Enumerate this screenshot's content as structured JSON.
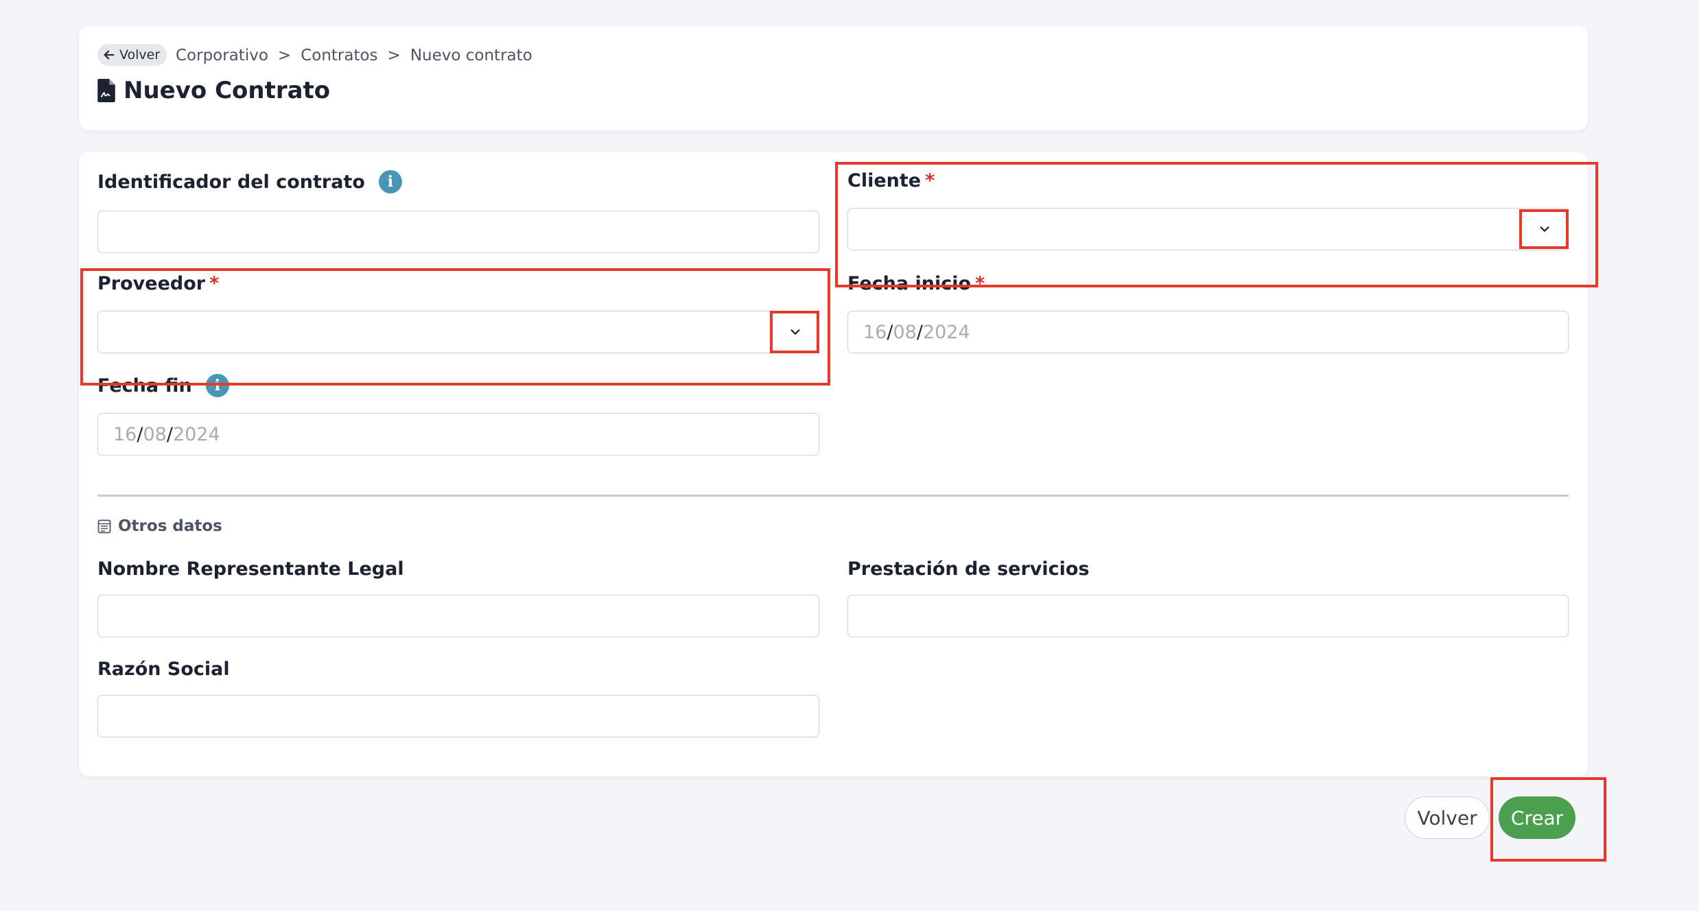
{
  "header": {
    "back_label": "Volver",
    "breadcrumb": [
      "Corporativo",
      "Contratos",
      "Nuevo contrato"
    ],
    "breadcrumb_separator": ">",
    "title": "Nuevo Contrato"
  },
  "form": {
    "contract_id": {
      "label": "Identificador del contrato",
      "value": "",
      "info_icon": "info-icon"
    },
    "client": {
      "label": "Cliente",
      "required_mark": "*",
      "value": ""
    },
    "provider": {
      "label": "Proveedor",
      "required_mark": "*",
      "value": ""
    },
    "start_date": {
      "label": "Fecha inicio",
      "required_mark": "*",
      "day": "16",
      "month": "08",
      "year": "2024",
      "sep": "/"
    },
    "end_date": {
      "label": "Fecha fin",
      "info_icon": "info-icon",
      "day": "16",
      "month": "08",
      "year": "2024",
      "sep": "/"
    }
  },
  "other": {
    "section_title": "Otros datos",
    "legal_rep": {
      "label": "Nombre Representante Legal",
      "value": ""
    },
    "services": {
      "label": "Prestación de servicios",
      "value": ""
    },
    "company_name": {
      "label": "Razón Social",
      "value": ""
    }
  },
  "actions": {
    "back": "Volver",
    "create": "Crear"
  },
  "colors": {
    "primary": "#4aa04e",
    "required": "#d32f2f",
    "info": "#4796b6",
    "highlight": "#e53a2a"
  }
}
